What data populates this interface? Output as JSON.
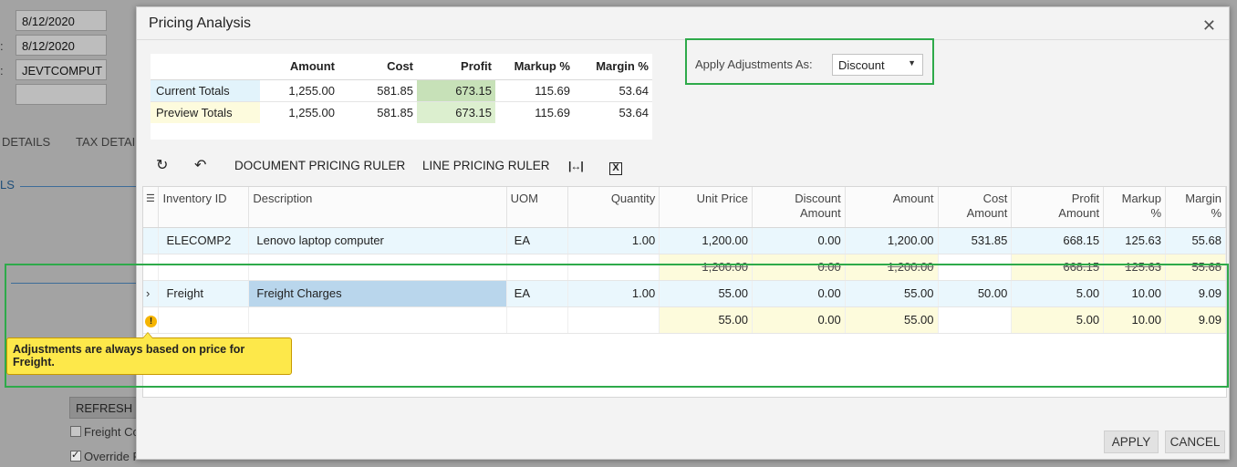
{
  "background": {
    "fields": [
      "8/12/2020",
      "8/12/2020",
      "JEVTCOMPUT",
      ""
    ],
    "tabs": [
      "DETAILS",
      "TAX DETAI"
    ],
    "refresh_label": "REFRESH",
    "freight_check_label": "Freight Co",
    "override_check_label": "Override F"
  },
  "dialog": {
    "title": "Pricing Analysis",
    "close_icon": "close-icon"
  },
  "totals": {
    "columns": [
      "Amount",
      "Cost",
      "Profit",
      "Markup %",
      "Margin %"
    ],
    "rows": [
      {
        "label": "Current Totals",
        "values": [
          "1,255.00",
          "581.85",
          "673.15",
          "115.69",
          "53.64"
        ]
      },
      {
        "label": "Preview Totals",
        "values": [
          "1,255.00",
          "581.85",
          "673.15",
          "115.69",
          "53.64"
        ]
      }
    ]
  },
  "adjustments": {
    "label": "Apply Adjustments As:",
    "value": "Discount"
  },
  "toolbar": {
    "refresh_icon": "refresh-icon",
    "undo_icon": "undo-icon",
    "document_ruler": "DOCUMENT PRICING RULER",
    "line_ruler": "LINE PRICING RULER",
    "fit_columns_icon": "fit-columns-icon",
    "export_excel_icon": "export-excel-icon"
  },
  "grid": {
    "columns": {
      "inventory_id": "Inventory ID",
      "description": "Description",
      "uom": "UOM",
      "quantity": "Quantity",
      "unit_price": "Unit Price",
      "discount_amount": [
        "Discount",
        "Amount"
      ],
      "amount": "Amount",
      "cost_amount": [
        "Cost",
        "Amount"
      ],
      "profit_amount": [
        "Profit",
        "Amount"
      ],
      "markup": [
        "Markup",
        "%"
      ],
      "margin": [
        "Margin",
        "%"
      ]
    },
    "rows": [
      {
        "inventory_id": "ELECOMP2",
        "description": "Lenovo laptop computer",
        "uom": "EA",
        "quantity": "1.00",
        "unit_price": "1,200.00",
        "discount_amount": "0.00",
        "amount": "1,200.00",
        "cost_amount": "531.85",
        "profit_amount": "668.15",
        "markup": "125.63",
        "margin": "55.68",
        "preview": {
          "unit_price": "1,200.00",
          "discount_amount": "0.00",
          "amount": "1,200.00",
          "profit_amount": "668.15",
          "markup": "125.63",
          "margin": "55.68"
        }
      },
      {
        "inventory_id": "Freight",
        "description": "Freight Charges",
        "uom": "EA",
        "quantity": "1.00",
        "unit_price": "55.00",
        "discount_amount": "0.00",
        "amount": "55.00",
        "cost_amount": "50.00",
        "profit_amount": "5.00",
        "markup": "10.00",
        "margin": "9.09",
        "preview": {
          "unit_price": "55.00",
          "discount_amount": "0.00",
          "amount": "55.00",
          "profit_amount": "5.00",
          "markup": "10.00",
          "margin": "9.09"
        }
      }
    ],
    "warning_icon": "!",
    "tooltip": "Adjustments are always based on price for Freight."
  },
  "buttons": {
    "apply": "APPLY",
    "cancel": "CANCEL"
  },
  "colors": {
    "highlight_green": "#2eaa4a",
    "tooltip_yellow": "#fde84a",
    "row_blue": "#eaf7fd",
    "preview_yellow": "#fdfbdc"
  }
}
